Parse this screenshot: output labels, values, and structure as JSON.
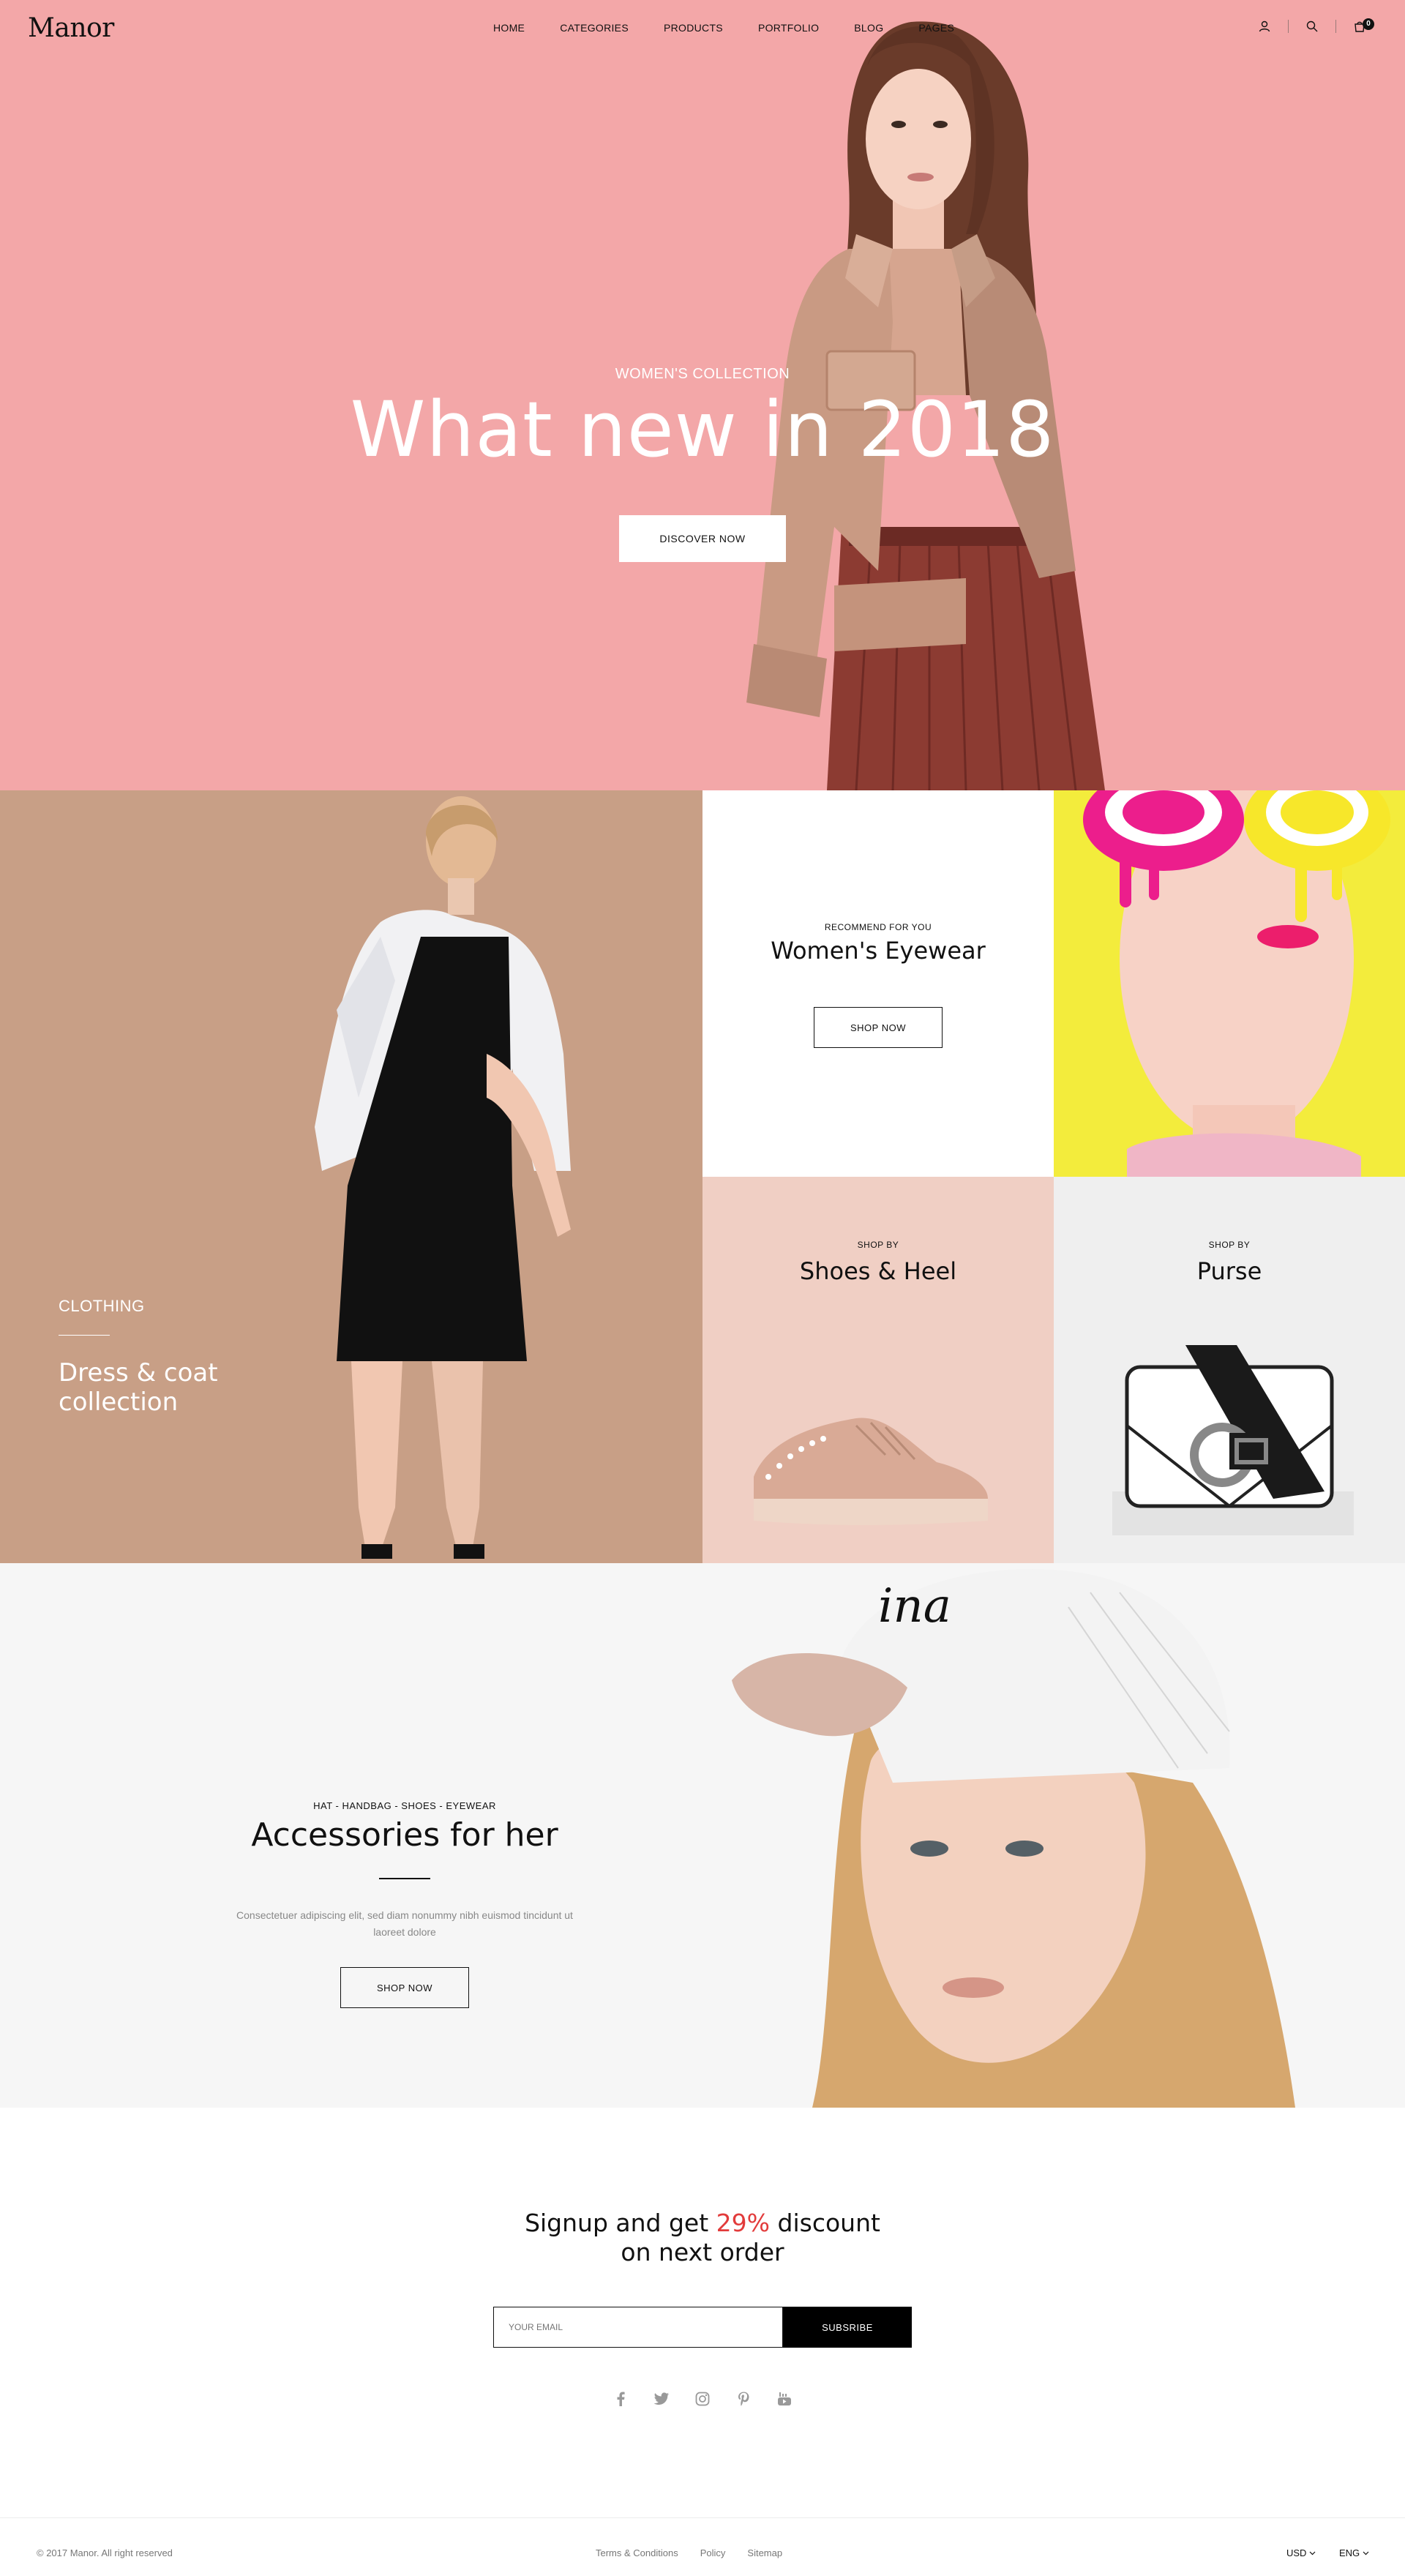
{
  "header": {
    "logo": "Manor",
    "nav": [
      "HOME",
      "CATEGORIES",
      "PRODUCTS",
      "PORTFOLIO",
      "BLOG",
      "PAGES"
    ],
    "cart_count": "0"
  },
  "hero": {
    "subtitle": "WOMEN'S COLLECTION",
    "title": "What new in 2018",
    "button": "DISCOVER NOW"
  },
  "clothing": {
    "label": "CLOTHING",
    "title": "Dress & coat collection"
  },
  "eyewear": {
    "sub": "RECOMMEND FOR YOU",
    "title": "Women's Eyewear",
    "button": "SHOP NOW"
  },
  "shoes": {
    "sub": "SHOP BY",
    "title": "Shoes & Heel"
  },
  "purse": {
    "sub": "SHOP BY",
    "title": "Purse"
  },
  "accessories": {
    "sub": "HAT - HANDBAG - SHOES - EYEWEAR",
    "title": "Accessories for her",
    "desc": "Consectetuer adipiscing elit, sed diam nonummy nibh euismod tincidunt ut laoreet dolore",
    "button": "SHOP NOW",
    "cap_text": "ina"
  },
  "newsletter": {
    "title_pre": "Signup and get ",
    "title_highlight": "29%",
    "title_post": " discount",
    "title_line2": "on next order",
    "placeholder": "YOUR EMAIL",
    "button": "SUBSRIBE",
    "highlight_color": "#e23b3b"
  },
  "socials": [
    "facebook-icon",
    "twitter-icon",
    "instagram-icon",
    "pinterest-icon",
    "youtube-icon"
  ],
  "footer": {
    "copyright": "© 2017 Manor. All right reserved",
    "links": [
      "Terms & Conditions",
      "Policy",
      "Sitemap"
    ],
    "currency": "USD",
    "language": "ENG"
  },
  "colors": {
    "hero_bg": "#f3a7a8",
    "clothing_bg": "#c89f86",
    "eyewear_bg": "#f3ec3c",
    "shoes_bg": "#f0cfc4",
    "purse_bg": "#efefef",
    "accessories_bg": "#f6f6f6"
  }
}
